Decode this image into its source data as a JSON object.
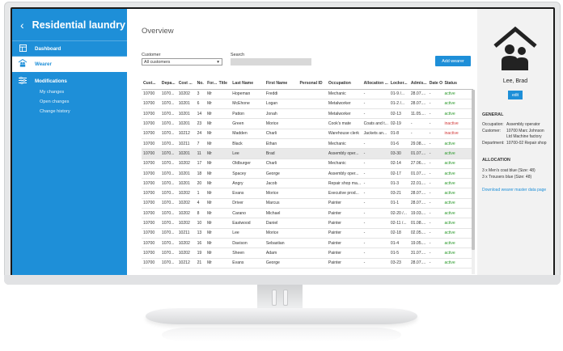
{
  "app": {
    "title": "Residential laundry"
  },
  "sidebar": {
    "items": [
      {
        "label": "Dashboard",
        "icon": "dashboard-icon"
      },
      {
        "label": "Wearer",
        "icon": "people-icon",
        "active": true
      }
    ],
    "modifications": {
      "label": "Modifications",
      "icon": "sliders-icon",
      "sub": [
        "My changes",
        "Open changes",
        "Change history"
      ]
    }
  },
  "main": {
    "title": "Overview",
    "customer_label": "Customer",
    "customer_value": "All customers",
    "search_label": "Search",
    "add_button": "Add wearer",
    "columns": [
      "Cust...",
      "Depa...",
      "Cost ...",
      "No.",
      "For...",
      "Title",
      "Last Name",
      "First Name",
      "Personal ID",
      "Occupation",
      "Allocation ...",
      "Locker...",
      "Admis...",
      "Date O...",
      "Status"
    ],
    "rows": [
      [
        "10700",
        "1070...",
        "10202",
        "3",
        "Mr",
        "",
        "Hopeman",
        "Freddi",
        "",
        "Mechanic",
        "-",
        "01-9 /...",
        "28.07....",
        "-",
        "active"
      ],
      [
        "10700",
        "1070...",
        "10201",
        "6",
        "Mr",
        "",
        "McEhone",
        "Logan",
        "",
        "Metalworker",
        "-",
        "01-2 /...",
        "28.07....",
        "-",
        "active"
      ],
      [
        "10700",
        "1070...",
        "10201",
        "14",
        "Mr",
        "",
        "Patton",
        "Jonah",
        "",
        "Metalworker",
        "-",
        "02-13",
        "11.05....",
        "-",
        "active"
      ],
      [
        "10700",
        "1070...",
        "10201",
        "23",
        "Mr",
        "",
        "Green",
        "Morice",
        "",
        "Cook's mate",
        "Coats and t...",
        "02-19",
        "-",
        "-",
        "inactive"
      ],
      [
        "10700",
        "1070...",
        "10212",
        "24",
        "Mr",
        "",
        "Madden",
        "Charli",
        "",
        "Warehouse clerk",
        "Jackets an...",
        "01-8",
        "-",
        "-",
        "inactive"
      ],
      [
        "10700",
        "1070...",
        "10211",
        "7",
        "Mr",
        "",
        "Black",
        "Ethan",
        "",
        "Mechanic",
        "-",
        "01-6",
        "29.08....",
        "-",
        "active"
      ],
      [
        "10700",
        "1070...",
        "10201",
        "11",
        "Mr",
        "",
        "Lee",
        "Brad",
        "",
        "Assembly oper...",
        "-",
        "03-30",
        "01.07....",
        "-",
        "active"
      ],
      [
        "10700",
        "1070...",
        "10202",
        "17",
        "Mr",
        "",
        "Oldburger",
        "Charli",
        "",
        "Mechanic",
        "-",
        "02-14",
        "27.06....",
        "-",
        "active"
      ],
      [
        "10700",
        "1070...",
        "10201",
        "18",
        "Mr",
        "",
        "Spacey",
        "George",
        "",
        "Assembly oper...",
        "-",
        "02-17",
        "01.07....",
        "-",
        "active"
      ],
      [
        "10700",
        "1070...",
        "10201",
        "20",
        "Mr",
        "",
        "Angry",
        "Jacob",
        "",
        "Repair shop ma...",
        "-",
        "01-3",
        "22.01....",
        "-",
        "active"
      ],
      [
        "10700",
        "1070...",
        "10202",
        "1",
        "Mr",
        "",
        "Evans",
        "Morice",
        "",
        "Executive prod...",
        "-",
        "03-21",
        "28.07....",
        "-",
        "active"
      ],
      [
        "10700",
        "1070...",
        "10202",
        "4",
        "Mr",
        "",
        "Driver",
        "Marcus",
        "",
        "Painter",
        "-",
        "01-1",
        "28.07....",
        "-",
        "active"
      ],
      [
        "10700",
        "1070...",
        "10202",
        "8",
        "Mr",
        "",
        "Carano",
        "Michael",
        "",
        "Painter",
        "-",
        "02-20 /...",
        "19.03....",
        "-",
        "active"
      ],
      [
        "10700",
        "1070...",
        "10202",
        "10",
        "Mr",
        "",
        "Eastwood",
        "Daniel",
        "",
        "Painter",
        "-",
        "02-11 /...",
        "01.08....",
        "-",
        "active"
      ],
      [
        "10700",
        "1070...",
        "10211",
        "13",
        "Mr",
        "",
        "Lee",
        "Morice",
        "",
        "Painter",
        "-",
        "02-18",
        "02.05....",
        "-",
        "active"
      ],
      [
        "10700",
        "1070...",
        "10202",
        "16",
        "Mr",
        "",
        "Davison",
        "Sebastian",
        "",
        "Painter",
        "-",
        "01-4",
        "19.05....",
        "-",
        "active"
      ],
      [
        "10700",
        "1070...",
        "10202",
        "19",
        "Mr",
        "",
        "Sheen",
        "Adam",
        "",
        "Painter",
        "-",
        "01-5",
        "31.07....",
        "-",
        "active"
      ],
      [
        "10700",
        "1070...",
        "10212",
        "21",
        "Mr",
        "",
        "Evans",
        "George",
        "",
        "Painter",
        "-",
        "03-23",
        "28.07....",
        "-",
        "active"
      ]
    ]
  },
  "detail": {
    "name": "Lee, Brad",
    "edit_label": "edit",
    "general_title": "GENERAL",
    "general": [
      {
        "k": "Occupation:",
        "v": "Assembly operator"
      },
      {
        "k": "Customer:",
        "v": "10700 Marc Johnson Ltd Machine factory"
      },
      {
        "k": "Department:",
        "v": "10700-02 Repair shop"
      }
    ],
    "allocation_title": "ALLOCATION",
    "allocation": [
      "3 x  Men's coat blue (Size: 48)",
      "3 x  Trousers blue (Size: 48)"
    ],
    "download_link": "Download wearer master data page"
  },
  "colors": {
    "accent": "#1e8fd8",
    "active": "#2c9a2c",
    "inactive": "#d23b3b"
  }
}
